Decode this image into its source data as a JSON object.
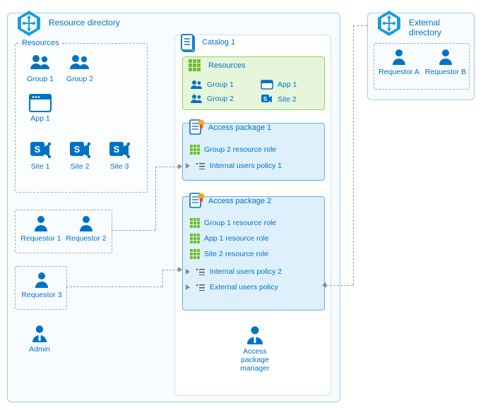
{
  "resource_directory": {
    "title": "Resource directory",
    "resources_title": "Resources",
    "groups": [
      "Group 1",
      "Group 2"
    ],
    "apps": [
      "App 1"
    ],
    "sites": [
      "Site 1",
      "Site 2",
      "Site 3"
    ],
    "requestors": [
      "Requestor 1",
      "Requestor 2",
      "Requestor 3"
    ],
    "admin": "Admin"
  },
  "catalog": {
    "title": "Catalog 1",
    "resources": {
      "title": "Resources",
      "items_left": [
        "Group 1",
        "Group 2"
      ],
      "items_right": [
        "App 1",
        "Site 2"
      ]
    },
    "access_packages": [
      {
        "title": "Access package 1",
        "roles": [
          "Group 2 resource role"
        ],
        "policies": [
          "Internal users policy 1"
        ]
      },
      {
        "title": "Access package 2",
        "roles": [
          "Group 1 resource role",
          "App 1 resource role",
          "Site 2 resource role"
        ],
        "policies": [
          "Internal users policy 2",
          "External users policy"
        ]
      }
    ],
    "manager": "Access package manager"
  },
  "external_directory": {
    "title": "External directory",
    "requestors": [
      "Requestor A",
      "Requestor B"
    ]
  }
}
